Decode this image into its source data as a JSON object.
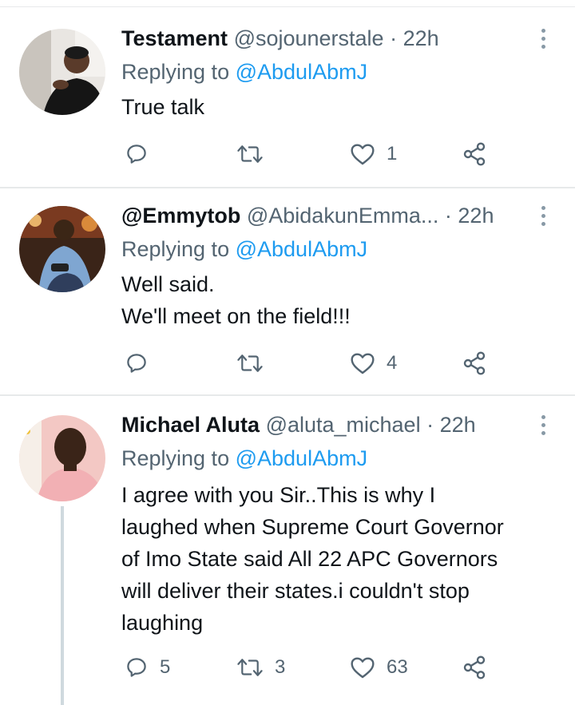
{
  "tweets": [
    {
      "name": "Testament",
      "handle": "@sojounerstale",
      "time": "22h",
      "replying_label": "Replying to",
      "replying_to": "@AbdulAbmJ",
      "lines": [
        "True talk"
      ],
      "reply_count": "",
      "retweet_count": "",
      "like_count": "1"
    },
    {
      "name": "@Emmytob",
      "handle": "@AbidakunEmma...",
      "time": "22h",
      "replying_label": "Replying to",
      "replying_to": "@AbdulAbmJ",
      "lines": [
        "Well said.",
        "We'll meet on the field!!!"
      ],
      "reply_count": "",
      "retweet_count": "",
      "like_count": "4"
    },
    {
      "name": "Michael Aluta",
      "handle": "@aluta_michael",
      "time": "22h",
      "replying_label": "Replying to",
      "replying_to": "@AbdulAbmJ",
      "lines": [
        "I agree with you Sir..This is why I",
        "laughed when Supreme Court Governor",
        "of Imo State said All 22 APC Governors",
        "will deliver their states.i couldn't stop",
        "laughing"
      ],
      "reply_count": "5",
      "retweet_count": "3",
      "like_count": "63"
    }
  ],
  "separator": "·",
  "colors": {
    "text": "#0f1419",
    "secondary": "#536471",
    "link": "#1d9bf0",
    "divider": "#e7e9ea"
  },
  "icons": [
    "reply-icon",
    "retweet-icon",
    "like-icon",
    "share-icon",
    "more-icon"
  ]
}
